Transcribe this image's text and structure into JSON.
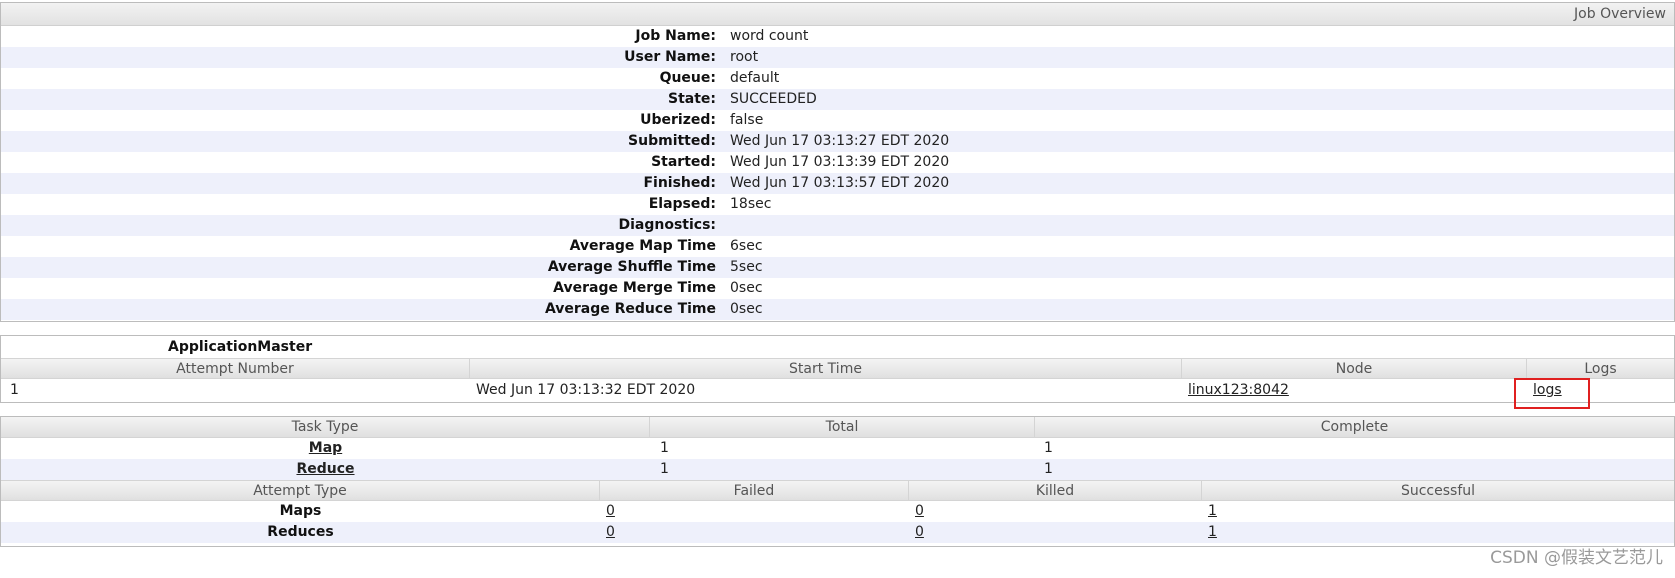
{
  "overview": {
    "header": "Job Overview",
    "rows": [
      {
        "label": "Job Name:",
        "value": "word count"
      },
      {
        "label": "User Name:",
        "value": "root"
      },
      {
        "label": "Queue:",
        "value": "default"
      },
      {
        "label": "State:",
        "value": "SUCCEEDED"
      },
      {
        "label": "Uberized:",
        "value": "false"
      },
      {
        "label": "Submitted:",
        "value": "Wed Jun 17 03:13:27 EDT 2020"
      },
      {
        "label": "Started:",
        "value": "Wed Jun 17 03:13:39 EDT 2020"
      },
      {
        "label": "Finished:",
        "value": "Wed Jun 17 03:13:57 EDT 2020"
      },
      {
        "label": "Elapsed:",
        "value": "18sec"
      },
      {
        "label": "Diagnostics:",
        "value": ""
      },
      {
        "label": "Average Map Time",
        "value": "6sec"
      },
      {
        "label": "Average Shuffle Time",
        "value": "5sec"
      },
      {
        "label": "Average Merge Time",
        "value": "0sec"
      },
      {
        "label": "Average Reduce Time",
        "value": "0sec"
      }
    ]
  },
  "application_master": {
    "title": "ApplicationMaster",
    "columns": [
      "Attempt Number",
      "Start Time",
      "Node",
      "Logs"
    ],
    "row": {
      "attempt_number": "1",
      "start_time": "Wed Jun 17 03:13:32 EDT 2020",
      "node": "linux123:8042",
      "logs": "logs"
    }
  },
  "tasks": {
    "columns": [
      "Task Type",
      "Total",
      "Complete"
    ],
    "rows": [
      {
        "type": "Map",
        "total": "1",
        "complete": "1"
      },
      {
        "type": "Reduce",
        "total": "1",
        "complete": "1"
      }
    ]
  },
  "attempts": {
    "columns": [
      "Attempt Type",
      "Failed",
      "Killed",
      "Successful"
    ],
    "rows": [
      {
        "type": "Maps",
        "failed": "0",
        "killed": "0",
        "successful": "1"
      },
      {
        "type": "Reduces",
        "failed": "0",
        "killed": "0",
        "successful": "1"
      }
    ]
  },
  "watermark": "CSDN @假装文艺范儿",
  "colors": {
    "highlight": "#e02020",
    "row_stripe": "#eef0fb"
  }
}
